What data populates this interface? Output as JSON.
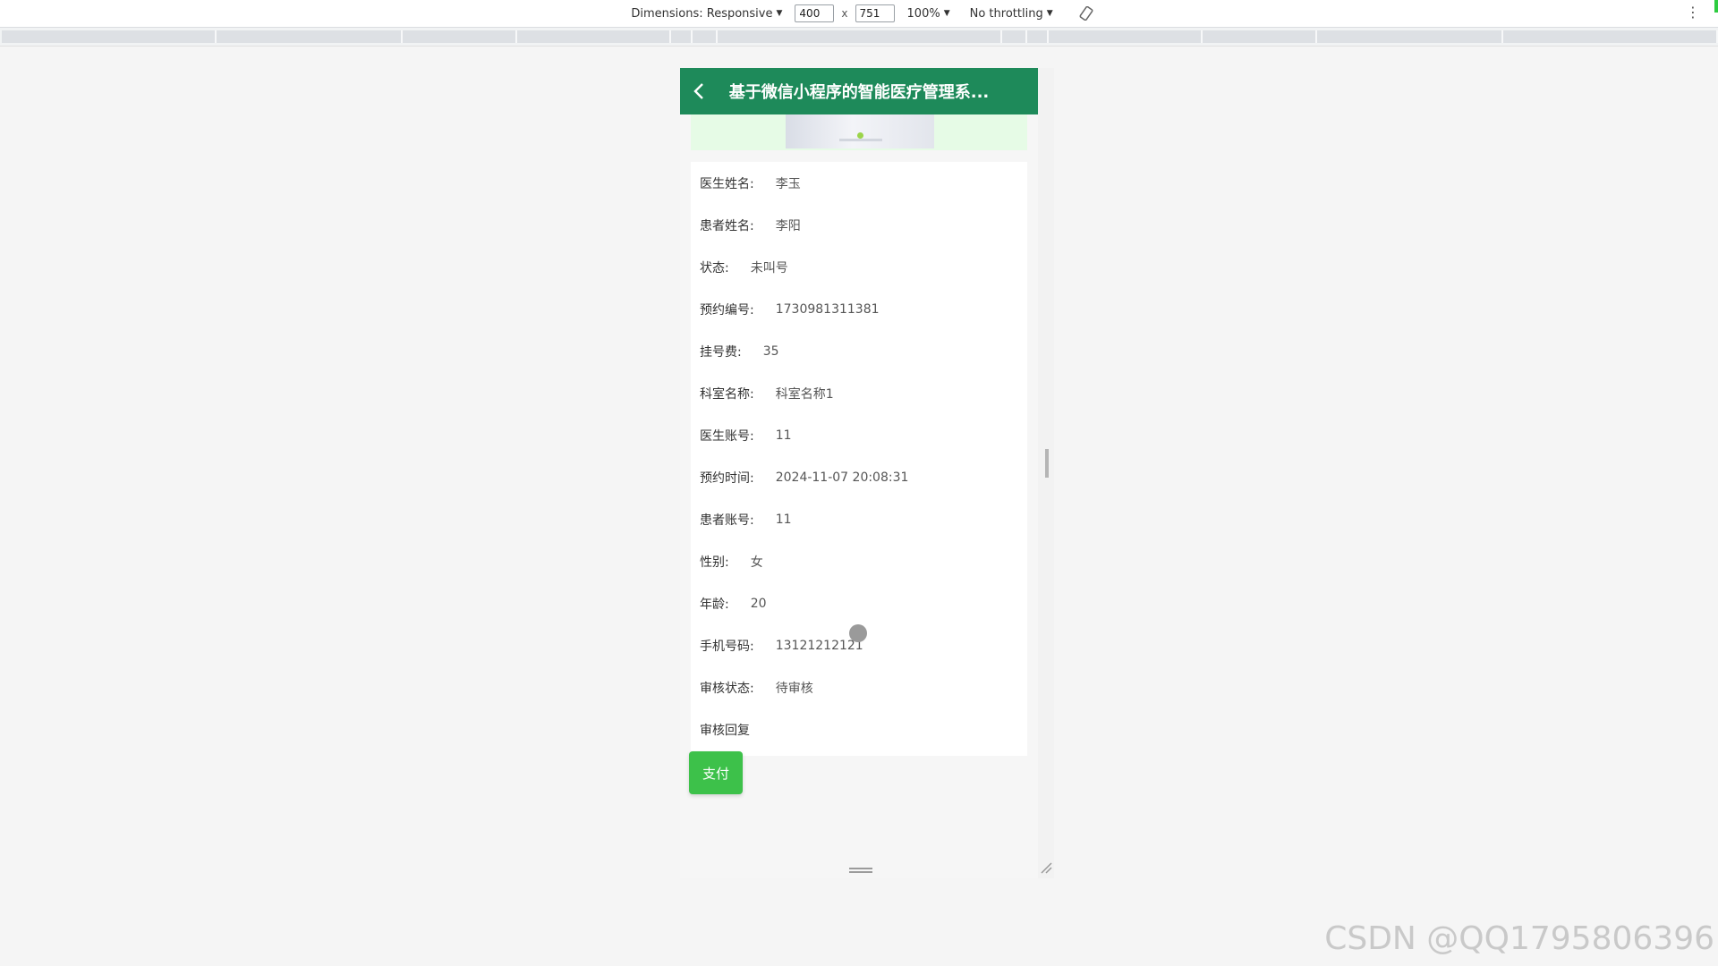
{
  "devtools": {
    "dimensions_label": "Dimensions: Responsive",
    "width_value": "400",
    "times": "x",
    "height_value": "751",
    "zoom_label": "100%",
    "throttling_label": "No throttling"
  },
  "app": {
    "nav_title": "基于微信小程序的智能医疗管理系..."
  },
  "fields": [
    {
      "label": "医生姓名:",
      "value": "李玉"
    },
    {
      "label": "患者姓名:",
      "value": "李阳"
    },
    {
      "label": "状态:",
      "value": "未叫号"
    },
    {
      "label": "预约编号:",
      "value": "1730981311381"
    },
    {
      "label": "挂号费:",
      "value": "35"
    },
    {
      "label": "科室名称:",
      "value": "科室名称1"
    },
    {
      "label": "医生账号:",
      "value": "11"
    },
    {
      "label": "预约时间:",
      "value": "2024-11-07 20:08:31"
    },
    {
      "label": "患者账号:",
      "value": "11"
    },
    {
      "label": "性别:",
      "value": "女"
    },
    {
      "label": "年龄:",
      "value": "20"
    },
    {
      "label": "手机号码:",
      "value": "13121212121"
    },
    {
      "label": "审核状态:",
      "value": "待审核"
    },
    {
      "label": "审核回复",
      "value": ""
    }
  ],
  "actions": {
    "pay_label": "支付"
  },
  "watermark": "CSDN @QQ1795806396",
  "colors": {
    "nav_bg": "#1e8a5a",
    "pay_button": "#3dc14a"
  }
}
